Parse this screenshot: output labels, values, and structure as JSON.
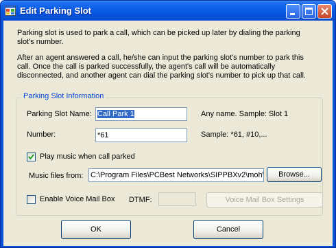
{
  "window": {
    "title": "Edit Parking Slot"
  },
  "description": {
    "para1": "Parking slot is used to park a call, which can be picked up later by dialing the parking slot's number.",
    "para2": "After an agent answered a call, he/she can input the parking slot's number to park this call. Once the call is parked successfully, the agent's call will be automatically disconnected, and another agent can dial the parking slot's number to pick up that call."
  },
  "group": {
    "legend": "Parking Slot Information",
    "name_label": "Parking Slot Name:",
    "name_value": "Call Park 1",
    "name_hint": "Any name. Sample: Slot 1",
    "number_label": "Number:",
    "number_value": "*61",
    "number_hint": "Sample: *61, #10,...",
    "play_music_label": "Play music when call parked",
    "play_music_checked": true,
    "music_files_label": "Music files from:",
    "music_files_value": "C:\\Program Files\\PCBest Networks\\SIPPBXv2\\moh\\",
    "browse_label": "Browse...",
    "voicemail_label": "Enable Voice Mail Box",
    "voicemail_checked": false,
    "dtmf_label": "DTMF:",
    "dtmf_value": "",
    "voicemail_settings_label": "Voice Mail Box Settings"
  },
  "buttons": {
    "ok": "OK",
    "cancel": "Cancel"
  },
  "colors": {
    "titlebar": "#0a5ce6",
    "dialog_bg": "#ece9d8",
    "group_legend": "#0046d5",
    "selection": "#316ac5"
  }
}
